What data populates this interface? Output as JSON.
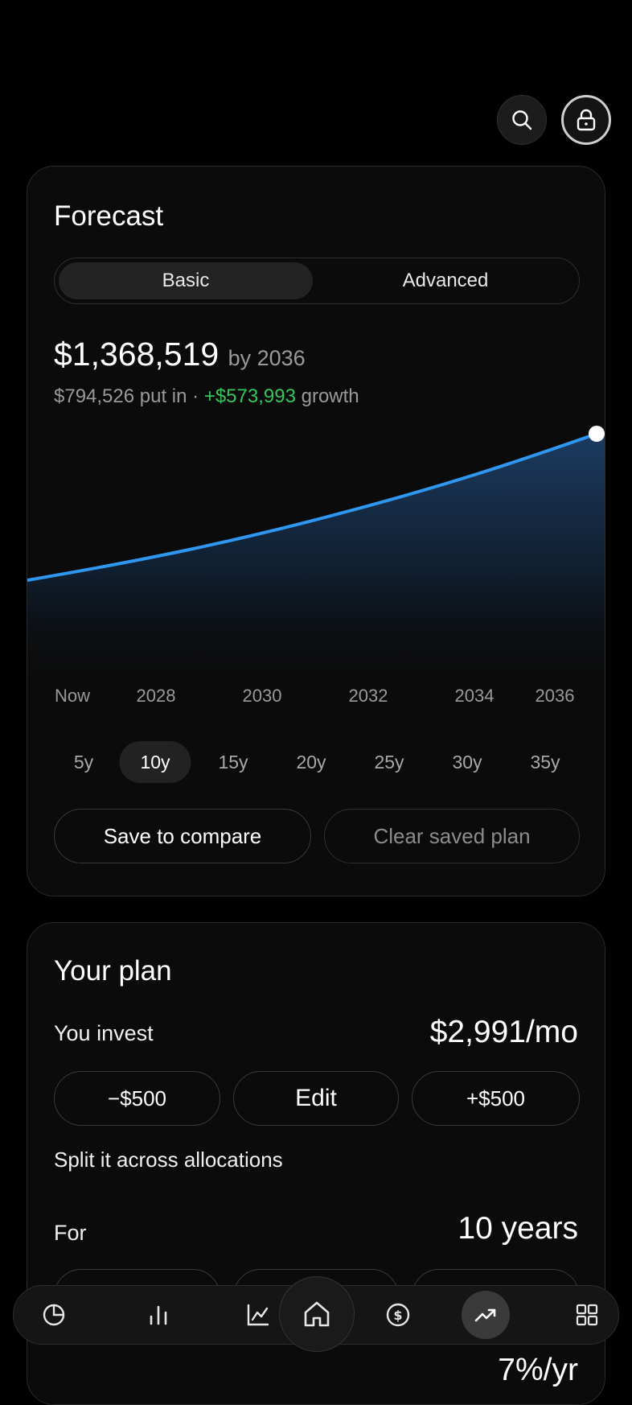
{
  "header": {
    "search_icon": "search-icon",
    "lock_icon": "lock-icon"
  },
  "forecast": {
    "title": "Forecast",
    "tabs": [
      {
        "label": "Basic",
        "active": true
      },
      {
        "label": "Advanced",
        "active": false
      }
    ],
    "total": "$1,368,519",
    "total_suffix": "by 2036",
    "put_in": "$794,526 put in · ",
    "growth": "+$573,993",
    "growth_suffix": " growth",
    "x_labels": [
      "Now",
      "2028",
      "2030",
      "2032",
      "2034",
      "2036"
    ],
    "ranges": [
      {
        "label": "5y",
        "active": false
      },
      {
        "label": "10y",
        "active": true
      },
      {
        "label": "15y",
        "active": false
      },
      {
        "label": "20y",
        "active": false
      },
      {
        "label": "25y",
        "active": false
      },
      {
        "label": "30y",
        "active": false
      },
      {
        "label": "35y",
        "active": false
      }
    ],
    "save_label": "Save to compare",
    "clear_label": "Clear saved plan",
    "colors": {
      "line": "#2f97f0",
      "growth": "#34c759"
    }
  },
  "plan": {
    "title": "Your plan",
    "invest_label": "You invest",
    "invest_value": "$2,991/mo",
    "minus_label": "−$500",
    "edit_label": "Edit",
    "plus_label": "+$500",
    "split_label": "Split it across allocations",
    "for_label": "For",
    "for_value": "10 years",
    "rate_value": "7%/yr"
  },
  "nav": {
    "items": [
      {
        "icon": "pie-chart-icon"
      },
      {
        "icon": "bar-chart-icon"
      },
      {
        "icon": "line-chart-icon"
      },
      {
        "icon": "home-icon",
        "raised": true
      },
      {
        "icon": "dollar-icon"
      },
      {
        "icon": "trending-up-icon",
        "active": true
      },
      {
        "icon": "grid-icon"
      }
    ]
  }
}
